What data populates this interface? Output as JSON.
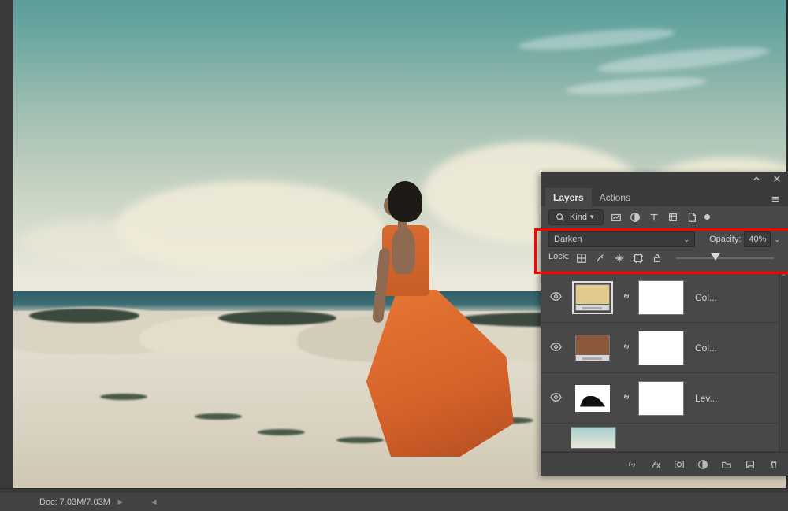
{
  "status": {
    "doc": "Doc: 7.03M/7.03M",
    "arrow_left": "◄",
    "arrow_right": "►"
  },
  "panel": {
    "tabs": [
      {
        "label": "Layers",
        "active": true
      },
      {
        "label": "Actions",
        "active": false
      }
    ],
    "filter": {
      "label": "Kind"
    },
    "blend": {
      "mode": "Darken",
      "opacity_label": "Opacity:",
      "opacity_value": "40%",
      "slider_percent": 40
    },
    "lock": {
      "label": "Lock:"
    },
    "layers": [
      {
        "name": "Col...",
        "type": "solid-color",
        "swatch": "#e3c98e",
        "selected": true
      },
      {
        "name": "Col...",
        "type": "solid-color",
        "swatch": "#8a5a3a",
        "selected": false
      },
      {
        "name": "Lev...",
        "type": "levels",
        "swatch": "#ffffff",
        "selected": false
      }
    ],
    "bg_layer": {
      "name": ""
    }
  },
  "colors": {
    "highlight_border": "#ff0000"
  }
}
